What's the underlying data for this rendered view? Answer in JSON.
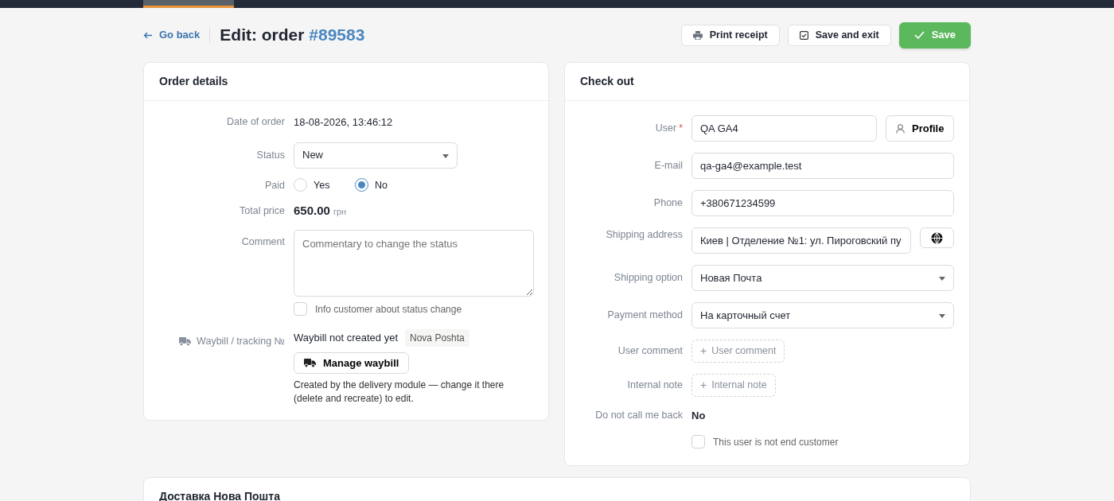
{
  "top_nav": {
    "tabs": [
      {
        "selected": true
      }
    ]
  },
  "header": {
    "back": "Go back",
    "title": "Edit: order",
    "order_number": "#89583",
    "buttons": [
      {
        "kind": "print",
        "label": "Print receipt"
      },
      {
        "kind": "exit",
        "label": "Save and exit"
      },
      {
        "kind": "save",
        "label": "Save"
      }
    ]
  },
  "order_details": {
    "title": "Order details",
    "rows": [
      {
        "kind": "text",
        "label": "Date of order",
        "value": "18-08-2026, 13:46:12"
      },
      {
        "kind": "select",
        "label": "Status",
        "value": "New"
      },
      {
        "kind": "radio",
        "label": "Paid",
        "options": [
          {
            "label": "Yes",
            "selected": false
          },
          {
            "label": "No",
            "selected": true
          }
        ]
      },
      {
        "kind": "price",
        "label": "Total price",
        "value": "650.00",
        "unit": "грн"
      },
      {
        "kind": "textarea",
        "label": "Comment",
        "placeholder": "Commentary to change the status",
        "checkbox": {
          "label": "Info customer about status change",
          "checked": false
        }
      },
      {
        "kind": "waybill",
        "label": "Waybill / tracking №",
        "value": "Waybill not created yet",
        "carrier": "Nova Poshta",
        "button": "Manage waybill",
        "note": "Created by the delivery module — change it there (delete and recreate) to edit."
      }
    ]
  },
  "check_out": {
    "title": "Check out",
    "rows": [
      {
        "kind": "input",
        "label": "User",
        "required_mark": "*",
        "value": "QA GA4",
        "button": "Profile"
      },
      {
        "kind": "input",
        "label": "E-mail",
        "value": "qa-ga4@example.test"
      },
      {
        "kind": "input",
        "label": "Phone",
        "value": "+380671234599"
      },
      {
        "kind": "address",
        "label": "Shipping address",
        "value": "Киев | Отделение №1: ул. Пироговский пу"
      },
      {
        "kind": "select",
        "label": "Shipping option",
        "value": "Новая Почта"
      },
      {
        "kind": "select",
        "label": "Payment method",
        "value": "На карточный счет"
      },
      {
        "kind": "add",
        "label": "User comment",
        "icon": "+",
        "button": "User comment"
      },
      {
        "kind": "add",
        "label": "Internal note",
        "icon": "+",
        "button": "Internal note"
      },
      {
        "kind": "value",
        "label": "Do not call me back",
        "value": "No"
      },
      {
        "kind": "checkbox",
        "label": "This user is not end customer",
        "checked": false
      }
    ]
  },
  "delivery_card": {
    "title": "Доставка Нова Пошта"
  }
}
